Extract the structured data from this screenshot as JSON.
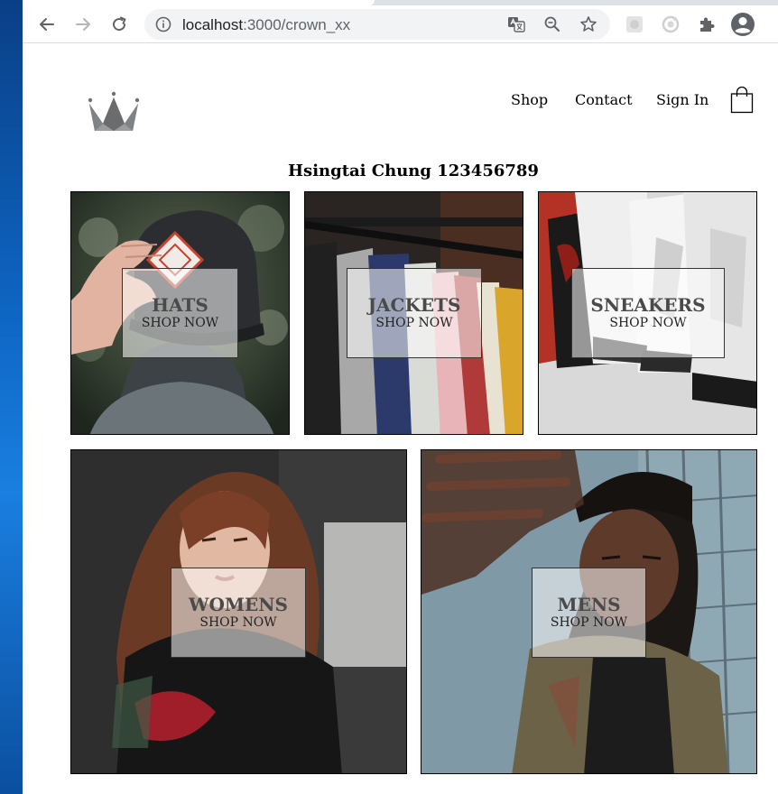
{
  "browser": {
    "url_host": "localhost",
    "url_path": ":3000/crown_xx"
  },
  "header": {
    "logo_icon": "crown-icon",
    "nav": [
      {
        "label": "Shop"
      },
      {
        "label": "Contact"
      },
      {
        "label": "Sign In"
      }
    ],
    "cart_icon": "shopping-bag-icon"
  },
  "page": {
    "title": "Hsingtai Chung 123456789"
  },
  "directory": [
    {
      "title": "HATS",
      "subtitle": "SHOP NOW"
    },
    {
      "title": "JACKETS",
      "subtitle": "SHOP NOW"
    },
    {
      "title": "SNEAKERS",
      "subtitle": "SHOP NOW"
    },
    {
      "title": "WOMENS",
      "subtitle": "SHOP NOW"
    },
    {
      "title": "MENS",
      "subtitle": "SHOP NOW"
    }
  ],
  "colors": {
    "desktop_blue": "#0b5aa8",
    "toolbar_icon": "#5f6368",
    "tile_border": "#000000"
  }
}
